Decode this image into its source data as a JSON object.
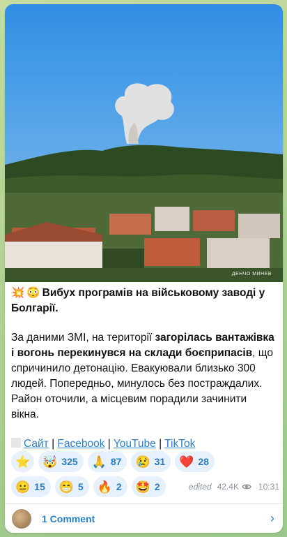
{
  "photo": {
    "watermark": "ДЕНЧО МИНЕВ"
  },
  "post": {
    "headline_emojis": [
      "💥",
      "😳"
    ],
    "headline": "Вибух програмів на військовому заводі у Болгарії.",
    "body_part1": "За даними ЗМІ, на території ",
    "body_bold": "загорілась вантажівка і вогонь перекинувся на склади боєприпасів",
    "body_part2": ", що спричинило детонацію. Евакуювали близько 300 людей. Попередньо, минулось без постраждалих. Район оточили, а місцевим порадили зачинити вікна.",
    "links": [
      {
        "label": "Сайт"
      },
      {
        "label": "Facebook"
      },
      {
        "label": "YouTube"
      },
      {
        "label": "TikTok"
      }
    ],
    "separator": "|"
  },
  "reactions": {
    "row1": [
      {
        "icon": "⭐",
        "count": ""
      },
      {
        "icon": "🤯",
        "count": "325"
      },
      {
        "icon": "🙏",
        "count": "87"
      },
      {
        "icon": "😢",
        "count": "31"
      },
      {
        "icon": "❤️",
        "count": "28"
      }
    ],
    "row2": [
      {
        "icon": "😐",
        "count": "15"
      },
      {
        "icon": "😁",
        "count": "5"
      },
      {
        "icon": "🔥",
        "count": "2"
      },
      {
        "icon": "🤩",
        "count": "2"
      }
    ]
  },
  "meta": {
    "edited": "edited",
    "views": "42.4K",
    "time": "10:31"
  },
  "comments": {
    "label": "1 Comment"
  }
}
